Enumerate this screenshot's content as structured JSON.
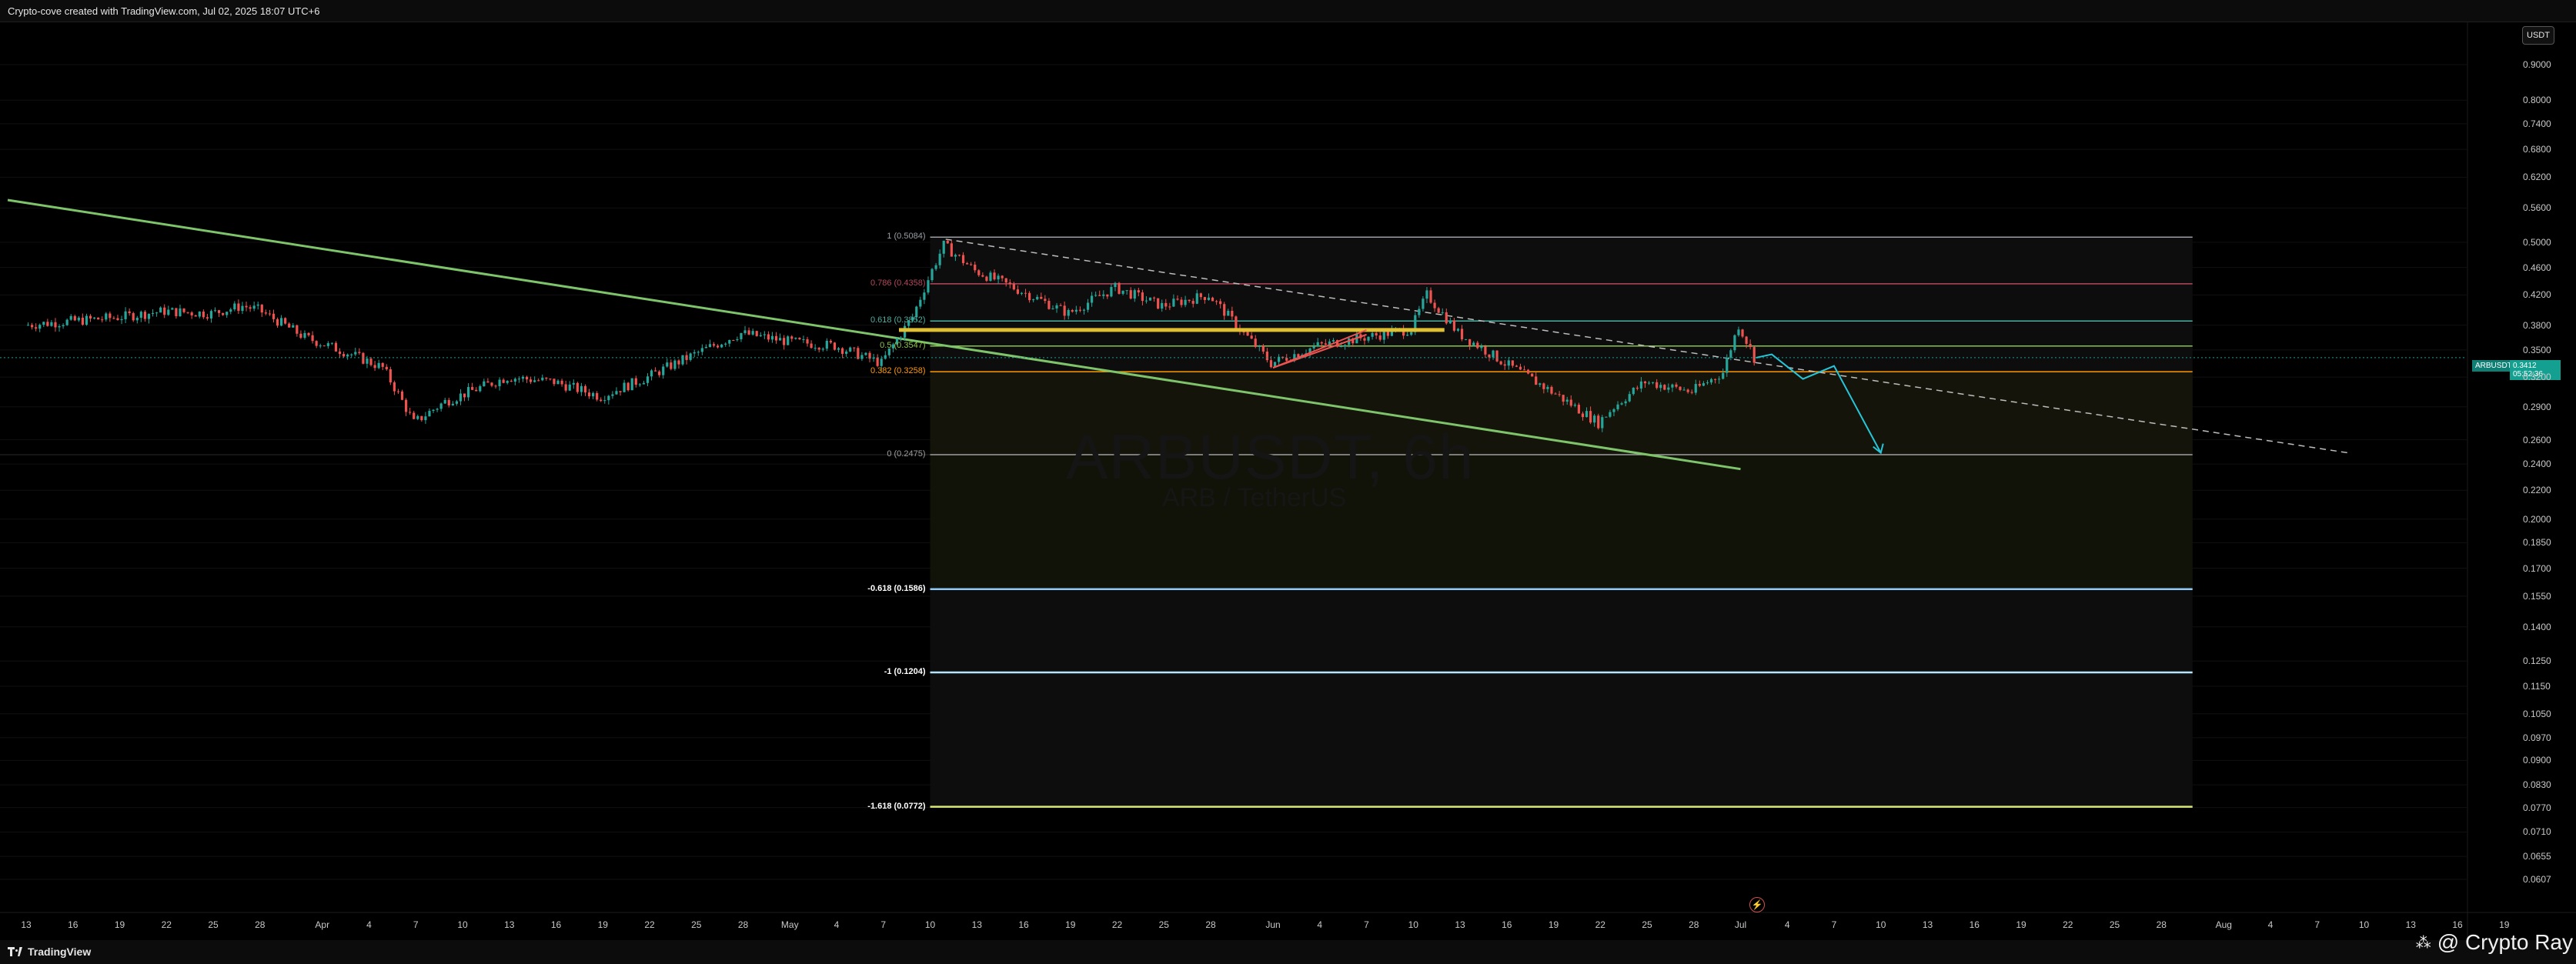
{
  "header": {
    "caption": "Crypto-cove created with TradingView.com, Jul 02, 2025 18:07 UTC+6"
  },
  "footer": {
    "brand": "TradingView",
    "author": "@ Crypto Ray"
  },
  "colors": {
    "background": "#000000",
    "up_candle": "#26a69a",
    "down_candle": "#ef5350",
    "trendline": "#7ec46b",
    "fib_1": "#9aa0a6",
    "fib_0786": "#b5475d",
    "fib_0618": "#4caf9f",
    "fib_05": "#8bc34a",
    "fib_0382": "#ff9800",
    "fib_0": "#9e9e9e",
    "fib_ext_0618": "#90caf9",
    "fib_ext_1": "#b3e5fc",
    "fib_ext_1618": "#dce775",
    "projection": "#26c6da",
    "support_zone": "#e0c030",
    "wedge": "#ef5350"
  },
  "chart_data": {
    "type": "candlestick",
    "symbol": "ARBUSDT, 6h",
    "subtitle": "ARB / TetherUS",
    "currency_button": "USDT",
    "last_price": "0.3412",
    "countdown": "05:52:36",
    "symbol_tag": "ARBUSDT",
    "y_scale": "log",
    "ylim": [
      0.0605,
      0.95
    ],
    "y_ticks": [
      "0.9000",
      "0.8000",
      "0.7400",
      "0.6800",
      "0.6200",
      "0.5600",
      "0.5000",
      "0.4600",
      "0.4200",
      "0.3800",
      "0.3500",
      "0.3200",
      "0.2900",
      "0.2600",
      "0.2400",
      "0.2200",
      "0.2000",
      "0.1850",
      "0.1700",
      "0.1550",
      "0.1400",
      "0.1250",
      "0.1150",
      "0.1050",
      "0.0970",
      "0.0900",
      "0.0830",
      "0.0770",
      "0.0710",
      "0.0655",
      "0.0607"
    ],
    "x_ticks": [
      "13",
      "16",
      "19",
      "22",
      "25",
      "28",
      "Apr",
      "4",
      "7",
      "10",
      "13",
      "16",
      "19",
      "22",
      "25",
      "28",
      "May",
      "4",
      "7",
      "10",
      "13",
      "16",
      "19",
      "22",
      "25",
      "28",
      "Jun",
      "4",
      "7",
      "10",
      "13",
      "16",
      "19",
      "22",
      "25",
      "28",
      "Jul",
      "4",
      "7",
      "10",
      "13",
      "16",
      "19",
      "22",
      "25",
      "28",
      "Aug",
      "4",
      "7",
      "10",
      "13",
      "16",
      "19"
    ],
    "x_range": [
      "2025-03-13",
      "2025-08-19"
    ],
    "close_series": [
      {
        "date": "2025-03-13",
        "close": 0.38
      },
      {
        "date": "2025-03-16",
        "close": 0.385
      },
      {
        "date": "2025-03-19",
        "close": 0.39
      },
      {
        "date": "2025-03-22",
        "close": 0.398
      },
      {
        "date": "2025-03-25",
        "close": 0.395
      },
      {
        "date": "2025-03-27",
        "close": 0.405
      },
      {
        "date": "2025-03-28",
        "close": 0.4
      },
      {
        "date": "2025-03-31",
        "close": 0.365
      },
      {
        "date": "2025-04-03",
        "close": 0.345
      },
      {
        "date": "2025-04-05",
        "close": 0.33
      },
      {
        "date": "2025-04-07",
        "close": 0.275
      },
      {
        "date": "2025-04-09",
        "close": 0.295
      },
      {
        "date": "2025-04-13",
        "close": 0.32
      },
      {
        "date": "2025-04-16",
        "close": 0.315
      },
      {
        "date": "2025-04-19",
        "close": 0.3
      },
      {
        "date": "2025-04-22",
        "close": 0.32
      },
      {
        "date": "2025-04-25",
        "close": 0.345
      },
      {
        "date": "2025-04-28",
        "close": 0.37
      },
      {
        "date": "2025-05-01",
        "close": 0.36
      },
      {
        "date": "2025-05-04",
        "close": 0.355
      },
      {
        "date": "2025-05-07",
        "close": 0.335
      },
      {
        "date": "2025-05-09",
        "close": 0.39
      },
      {
        "date": "2025-05-11",
        "close": 0.495
      },
      {
        "date": "2025-05-13",
        "close": 0.455
      },
      {
        "date": "2025-05-16",
        "close": 0.425
      },
      {
        "date": "2025-05-19",
        "close": 0.395
      },
      {
        "date": "2025-05-22",
        "close": 0.43
      },
      {
        "date": "2025-05-25",
        "close": 0.405
      },
      {
        "date": "2025-05-28",
        "close": 0.42
      },
      {
        "date": "2025-05-30",
        "close": 0.375
      },
      {
        "date": "2025-06-01",
        "close": 0.335
      },
      {
        "date": "2025-06-04",
        "close": 0.355
      },
      {
        "date": "2025-06-07",
        "close": 0.365
      },
      {
        "date": "2025-06-10",
        "close": 0.375
      },
      {
        "date": "2025-06-11",
        "close": 0.42
      },
      {
        "date": "2025-06-13",
        "close": 0.37
      },
      {
        "date": "2025-06-16",
        "close": 0.335
      },
      {
        "date": "2025-06-19",
        "close": 0.305
      },
      {
        "date": "2025-06-22",
        "close": 0.275
      },
      {
        "date": "2025-06-23",
        "close": 0.29
      },
      {
        "date": "2025-06-25",
        "close": 0.315
      },
      {
        "date": "2025-06-28",
        "close": 0.305
      },
      {
        "date": "2025-06-30",
        "close": 0.325
      },
      {
        "date": "2025-07-01",
        "close": 0.38
      },
      {
        "date": "2025-07-02",
        "close": 0.3412
      }
    ],
    "fib_levels": [
      {
        "label": "1 (0.5084)",
        "value": 0.5084,
        "color": "#9aa0a6"
      },
      {
        "label": "0.786 (0.4358)",
        "value": 0.4358,
        "color": "#b5475d"
      },
      {
        "label": "0.618 (0.3852)",
        "value": 0.3852,
        "color": "#4caf9f"
      },
      {
        "label": "0.5 (0.3547)",
        "value": 0.3547,
        "color": "#8bc34a"
      },
      {
        "label": "0.382 (0.3258)",
        "value": 0.3258,
        "color": "#ff9800"
      },
      {
        "label": "0 (0.2475)",
        "value": 0.2475,
        "color": "#9e9e9e"
      },
      {
        "label": "-0.618 (0.1586)",
        "value": 0.1586,
        "color": "#90caf9"
      },
      {
        "label": "-1 (0.1204)",
        "value": 0.1204,
        "color": "#b3e5fc"
      },
      {
        "label": "-1.618 (0.0772)",
        "value": 0.0772,
        "color": "#dce775"
      }
    ],
    "fib_range": [
      "2025-05-10",
      "2025-07-30"
    ],
    "trendline": [
      {
        "date": "2025-03-13",
        "value": 0.575
      },
      {
        "date": "2025-07-01",
        "value": 0.236
      }
    ],
    "dashed_trendline": [
      {
        "date": "2025-05-11",
        "value": 0.505
      },
      {
        "date": "2025-08-09",
        "value": 0.249
      }
    ],
    "support_zone": {
      "from": "2025-05-08",
      "to": "2025-06-12",
      "value": 0.374
    },
    "wedge": [
      {
        "date": "2025-06-01",
        "value": 0.33
      },
      {
        "date": "2025-06-07",
        "value": 0.374
      }
    ],
    "projection": [
      {
        "date": "2025-07-02",
        "value": 0.3412
      },
      {
        "date": "2025-07-03",
        "value": 0.345
      },
      {
        "date": "2025-07-05",
        "value": 0.318
      },
      {
        "date": "2025-07-07",
        "value": 0.332
      },
      {
        "date": "2025-07-10",
        "value": 0.249
      }
    ]
  }
}
